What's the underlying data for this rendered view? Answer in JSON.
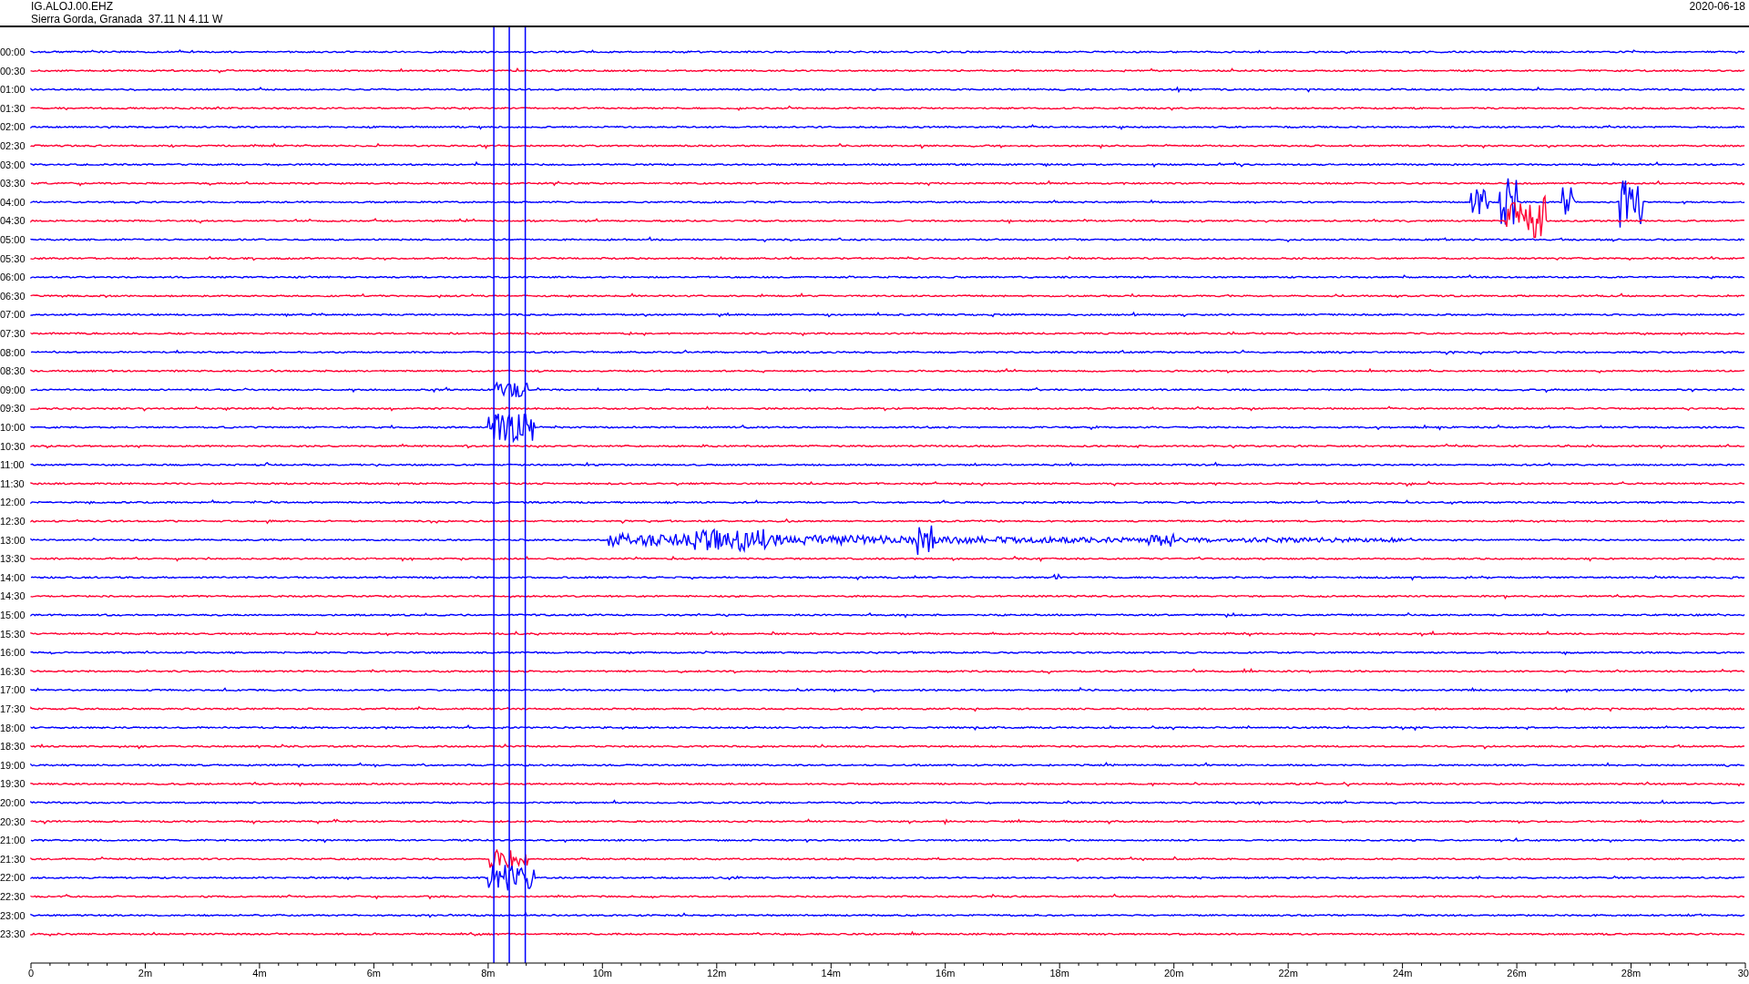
{
  "header": {
    "station": "IG.ALOJ.00.EHZ",
    "location": "Sierra Gorda, Granada  37.11 N 4.11 W",
    "date": "2020-06-18"
  },
  "rows": [
    {
      "time": "00:00",
      "color": "#0000ff"
    },
    {
      "time": "00:30",
      "color": "#ff0033"
    },
    {
      "time": "01:00",
      "color": "#0000ff"
    },
    {
      "time": "01:30",
      "color": "#ff0033"
    },
    {
      "time": "02:00",
      "color": "#0000ff"
    },
    {
      "time": "02:30",
      "color": "#ff0033"
    },
    {
      "time": "03:00",
      "color": "#0000ff"
    },
    {
      "time": "03:30",
      "color": "#ff0033"
    },
    {
      "time": "04:00",
      "color": "#0000ff"
    },
    {
      "time": "04:30",
      "color": "#ff0033"
    },
    {
      "time": "05:00",
      "color": "#0000ff"
    },
    {
      "time": "05:30",
      "color": "#ff0033"
    },
    {
      "time": "06:00",
      "color": "#0000ff"
    },
    {
      "time": "06:30",
      "color": "#ff0033"
    },
    {
      "time": "07:00",
      "color": "#0000ff"
    },
    {
      "time": "07:30",
      "color": "#ff0033"
    },
    {
      "time": "08:00",
      "color": "#0000ff"
    },
    {
      "time": "08:30",
      "color": "#ff0033"
    },
    {
      "time": "09:00",
      "color": "#0000ff"
    },
    {
      "time": "09:30",
      "color": "#ff0033"
    },
    {
      "time": "10:00",
      "color": "#0000ff"
    },
    {
      "time": "10:30",
      "color": "#ff0033"
    },
    {
      "time": "11:00",
      "color": "#0000ff"
    },
    {
      "time": "11:30",
      "color": "#ff0033"
    },
    {
      "time": "12:00",
      "color": "#0000ff"
    },
    {
      "time": "12:30",
      "color": "#ff0033"
    },
    {
      "time": "13:00",
      "color": "#0000ff"
    },
    {
      "time": "13:30",
      "color": "#ff0033"
    },
    {
      "time": "14:00",
      "color": "#0000ff"
    },
    {
      "time": "14:30",
      "color": "#ff0033"
    },
    {
      "time": "15:00",
      "color": "#0000ff"
    },
    {
      "time": "15:30",
      "color": "#ff0033"
    },
    {
      "time": "16:00",
      "color": "#0000ff"
    },
    {
      "time": "16:30",
      "color": "#ff0033"
    },
    {
      "time": "17:00",
      "color": "#0000ff"
    },
    {
      "time": "17:30",
      "color": "#ff0033"
    },
    {
      "time": "18:00",
      "color": "#0000ff"
    },
    {
      "time": "18:30",
      "color": "#ff0033"
    },
    {
      "time": "19:00",
      "color": "#0000ff"
    },
    {
      "time": "19:30",
      "color": "#ff0033"
    },
    {
      "time": "20:00",
      "color": "#0000ff"
    },
    {
      "time": "20:30",
      "color": "#ff0033"
    },
    {
      "time": "21:00",
      "color": "#0000ff"
    },
    {
      "time": "21:30",
      "color": "#ff0033"
    },
    {
      "time": "22:00",
      "color": "#0000ff"
    },
    {
      "time": "22:30",
      "color": "#ff0033"
    },
    {
      "time": "23:00",
      "color": "#0000ff"
    },
    {
      "time": "23:30",
      "color": "#ff0033"
    }
  ],
  "x_axis": {
    "ticks": [
      "0",
      "2m",
      "4m",
      "6m",
      "8m",
      "10m",
      "12m",
      "14m",
      "16m",
      "18m",
      "20m",
      "22m",
      "24m",
      "26m",
      "28m",
      "30"
    ]
  }
}
